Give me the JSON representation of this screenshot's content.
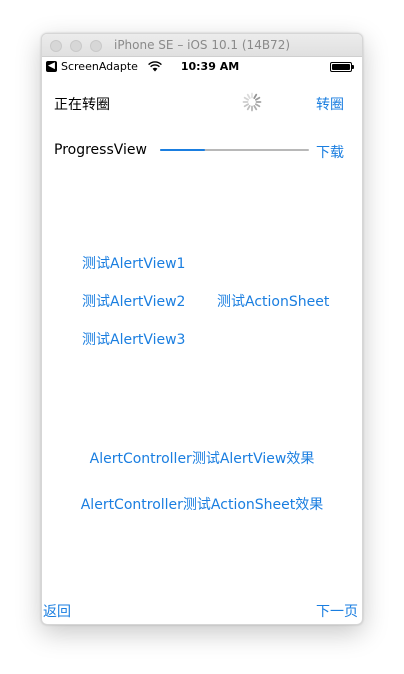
{
  "window": {
    "title": "iPhone SE – iOS 10.1 (14B72)"
  },
  "statusbar": {
    "back_glyph": "◀",
    "carrier": "ScreenAdapte",
    "time": "10:39 AM"
  },
  "rows": {
    "spinner_label": "正在转圈",
    "spinner_button": "转圈",
    "progress_label": "ProgressView",
    "download_button": "下载",
    "progress_value": 0.3
  },
  "alerts": {
    "alert1": "测试AlertView1",
    "alert2": "测试AlertView2",
    "action_sheet": "测试ActionSheet",
    "alert3": "测试AlertView3"
  },
  "controllers": {
    "alert_view_effect": "AlertController测试AlertView效果",
    "action_sheet_effect": "AlertController测试ActionSheet效果"
  },
  "bottom": {
    "back": "返回",
    "next": "下一页"
  },
  "colors": {
    "accent": "#1a7ee0",
    "track": "#b8b8b8"
  },
  "icons": [
    "wifi-icon",
    "battery-icon",
    "activity-spinner-icon"
  ]
}
